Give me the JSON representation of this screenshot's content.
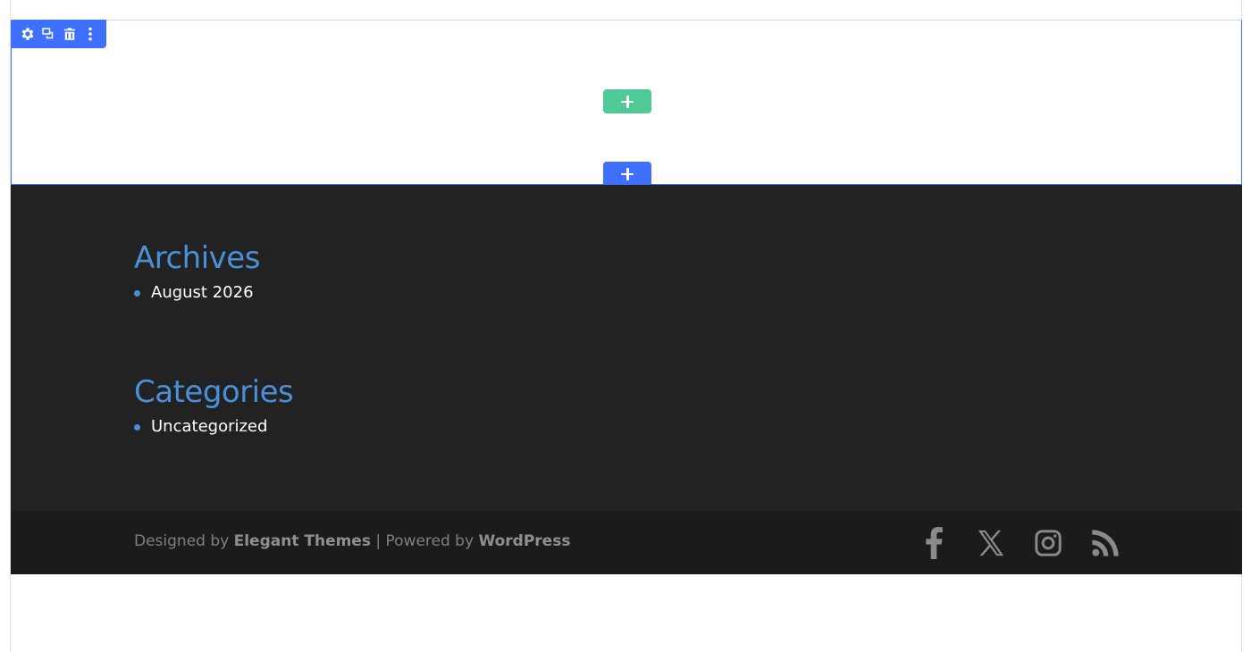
{
  "builder": {
    "section_toolbar": {
      "icons": [
        "gear-icon",
        "duplicate-icon",
        "trash-icon",
        "more-vertical-icon"
      ]
    },
    "add_row_button": {
      "icon": "plus-icon",
      "color": "#4fc996"
    },
    "add_section_button": {
      "icon": "plus-icon",
      "color": "#3e6fff"
    },
    "accent_color": "#3e6fff"
  },
  "footer": {
    "widgets": [
      {
        "title": "Archives",
        "items": [
          "August 2026"
        ]
      },
      {
        "title": "Categories",
        "items": [
          "Uncategorized"
        ]
      }
    ],
    "credits": {
      "designed_prefix": "Designed by",
      "designer": "Elegant Themes",
      "separator": "| Powered by",
      "platform": "WordPress"
    },
    "social_icons": [
      "facebook-icon",
      "x-icon",
      "instagram-icon",
      "rss-icon"
    ],
    "title_color": "#4a90d9",
    "background_color": "#222222",
    "bottom_bar_color": "#1b1b1b"
  }
}
